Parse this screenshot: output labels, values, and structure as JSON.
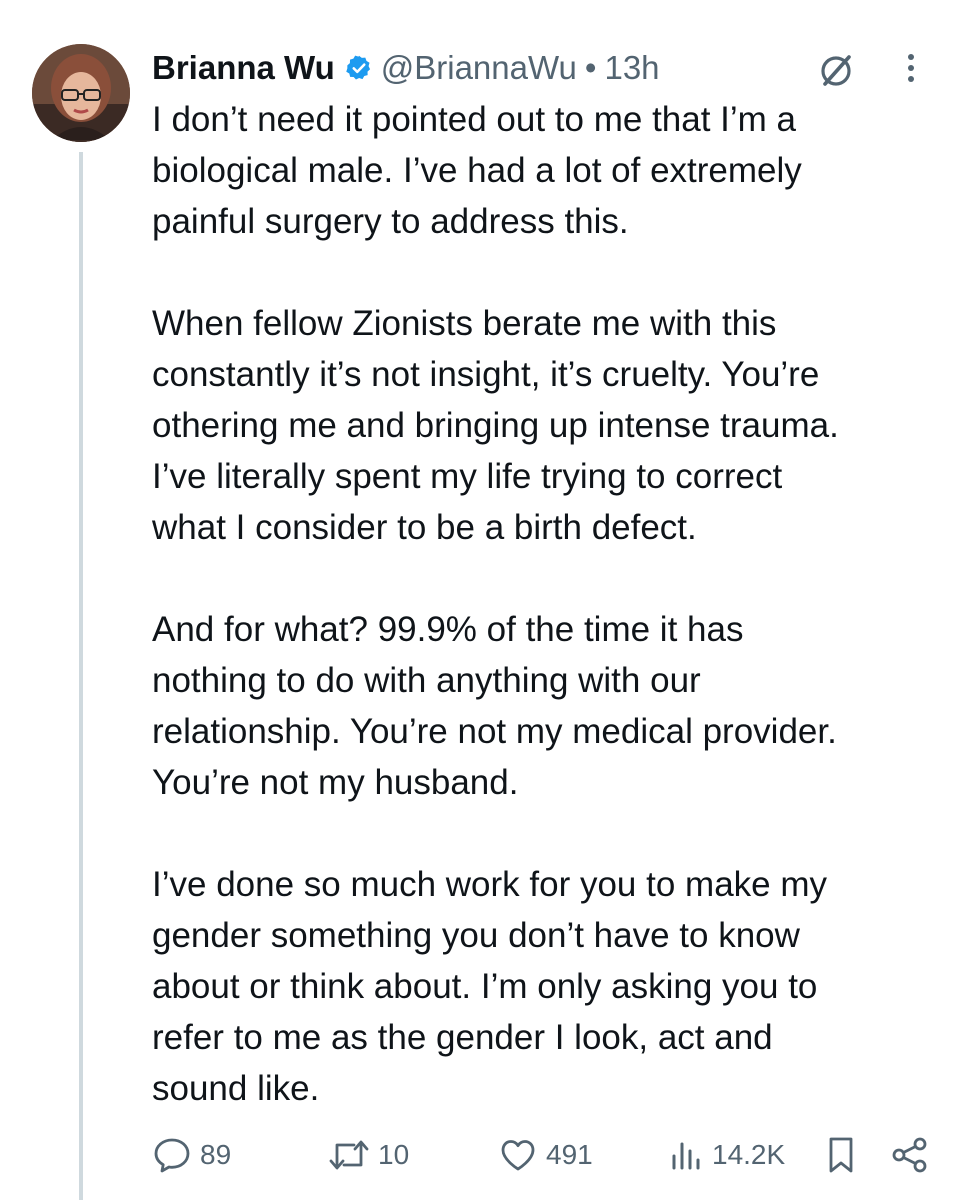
{
  "tweet": {
    "author_name": "Brianna Wu",
    "handle": "@BriannaWu",
    "separator": "•",
    "time": "13h",
    "paragraphs": [
      "I don’t need it pointed out to me that I’m a\nbiological male. I’ve had a lot of extremely\npainful surgery to address this.",
      "When fellow Zionists berate me with this\nconstantly it’s not insight, it’s cruelty. You’re\nothering me and bringing up intense trauma.\nI’ve literally spent my life trying to correct\nwhat I consider to be a birth defect.",
      "And for what? 99.9% of the time it has\nnothing to do with anything with our\nrelationship. You’re not my medical provider.\nYou’re not my husband.",
      "I’ve done so much work for you to make my\ngender something you don’t have to know\nabout or think about. I’m only asking you to\nrefer to me as the gender I look, act and\nsound like."
    ]
  },
  "actions": {
    "replies": "89",
    "reposts": "10",
    "likes": "491",
    "views": "14.2K"
  },
  "colors": {
    "verified": "#1d9bf0",
    "text": "#0f1419",
    "muted": "#536471",
    "thread_line": "#cfd9de"
  },
  "icons": [
    "verified-badge-icon",
    "grok-icon",
    "more-icon",
    "reply-icon",
    "repost-icon",
    "like-icon",
    "views-icon",
    "bookmark-icon",
    "share-icon"
  ]
}
